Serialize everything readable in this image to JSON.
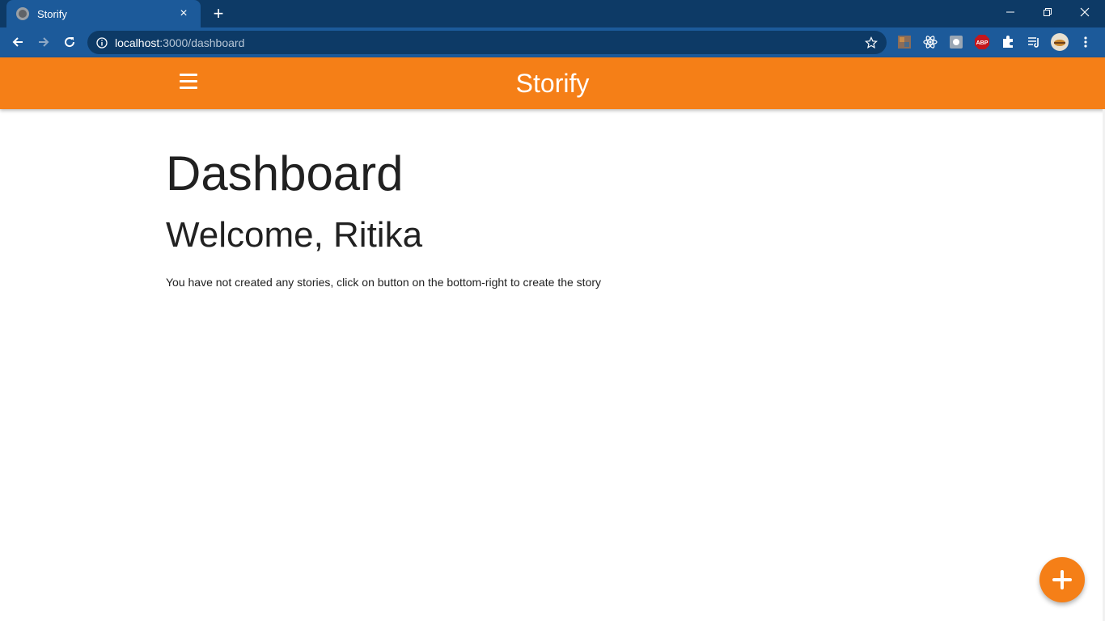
{
  "browser": {
    "tab_title": "Storify",
    "tab_close": "×",
    "new_tab": "+",
    "url_host": "localhost",
    "url_path": ":3000/dashboard"
  },
  "extensions": [
    "image-extension-icon",
    "react-devtools-icon",
    "camera-extension-icon",
    "adblock-plus-icon",
    "puzzle-extensions-icon",
    "reading-list-icon",
    "profile-avatar"
  ],
  "app": {
    "brand": "Storify",
    "accent_color": "#f57f17"
  },
  "main": {
    "title": "Dashboard",
    "welcome": "Welcome, Ritika",
    "message": "You have not created any stories, click on button on the bottom-right to create the story"
  },
  "fab": {
    "icon": "plus-icon"
  }
}
